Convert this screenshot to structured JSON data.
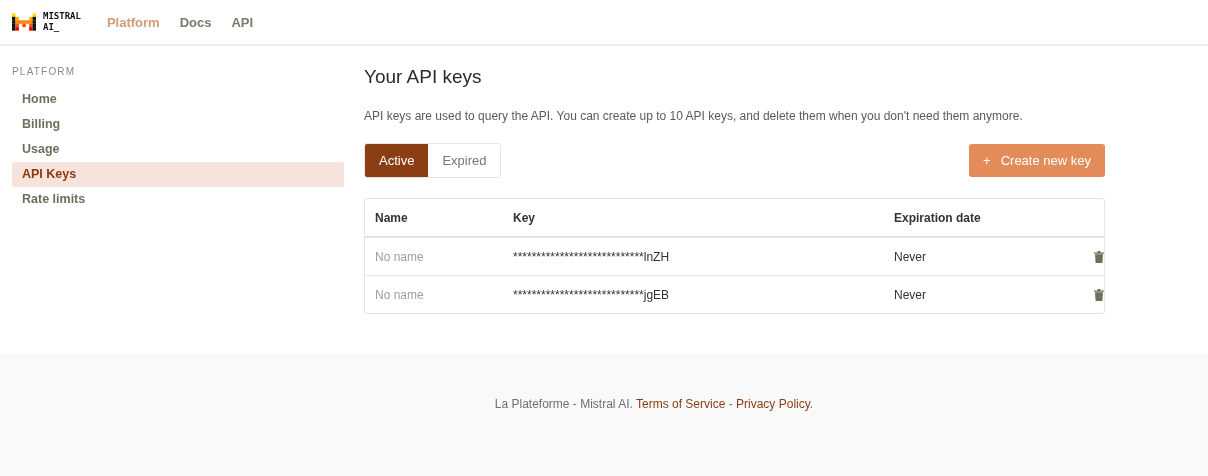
{
  "logo": {
    "line1": "MISTRAL",
    "line2": "AI_"
  },
  "nav": [
    {
      "label": "Platform",
      "selected": true
    },
    {
      "label": "Docs",
      "selected": false
    },
    {
      "label": "API",
      "selected": false
    }
  ],
  "sidebar": {
    "heading": "PLATFORM",
    "items": [
      {
        "label": "Home",
        "selected": false
      },
      {
        "label": "Billing",
        "selected": false
      },
      {
        "label": "Usage",
        "selected": false
      },
      {
        "label": "API Keys",
        "selected": true
      },
      {
        "label": "Rate limits",
        "selected": false
      }
    ]
  },
  "page": {
    "title": "Your API keys",
    "description": "API keys are used to query the API. You can create up to 10 API keys, and delete them when you don't need them anymore."
  },
  "filter_tabs": [
    {
      "label": "Active",
      "selected": true
    },
    {
      "label": "Expired",
      "selected": false
    }
  ],
  "create_button": {
    "icon": "+",
    "label": "Create new key"
  },
  "table": {
    "columns": [
      "Name",
      "Key",
      "Expiration date"
    ],
    "rows": [
      {
        "name": "No name",
        "key": "****************************lnZH",
        "expiration": "Never"
      },
      {
        "name": "No name",
        "key": "****************************jgEB",
        "expiration": "Never"
      }
    ]
  },
  "footer": {
    "parts": [
      {
        "kind": "text",
        "text": "La Plateforme - Mistral AI. "
      },
      {
        "kind": "link",
        "text": "Terms of Service"
      },
      {
        "kind": "text",
        "text": " - "
      },
      {
        "kind": "link",
        "text": "Privacy Policy"
      },
      {
        "kind": "text",
        "text": "."
      }
    ]
  }
}
